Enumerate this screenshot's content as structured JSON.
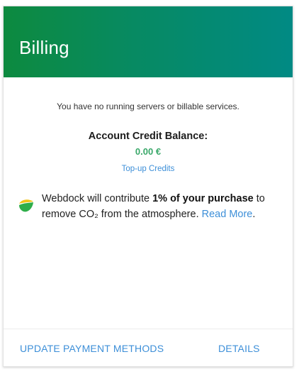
{
  "header": {
    "title": "Billing"
  },
  "billing": {
    "status_text": "You have no running servers or billable services.",
    "balance_label": "Account Credit Balance:",
    "balance_value": "0.00 €",
    "topup_label": "Top-up Credits"
  },
  "eco": {
    "icon": "leaf-icon",
    "text_before": "Webdock will contribute ",
    "text_bold": "1% of your purchase",
    "text_after": " to remove CO₂ from the atmosphere. ",
    "link_label": "Read More",
    "text_end": "."
  },
  "footer": {
    "update_label": "UPDATE PAYMENT METHODS",
    "details_label": "DETAILS"
  },
  "colors": {
    "header_gradient_start": "#0d8a3f",
    "header_gradient_end": "#018a84",
    "balance_green": "#3aa86a",
    "link_blue": "#3d8fd8"
  }
}
